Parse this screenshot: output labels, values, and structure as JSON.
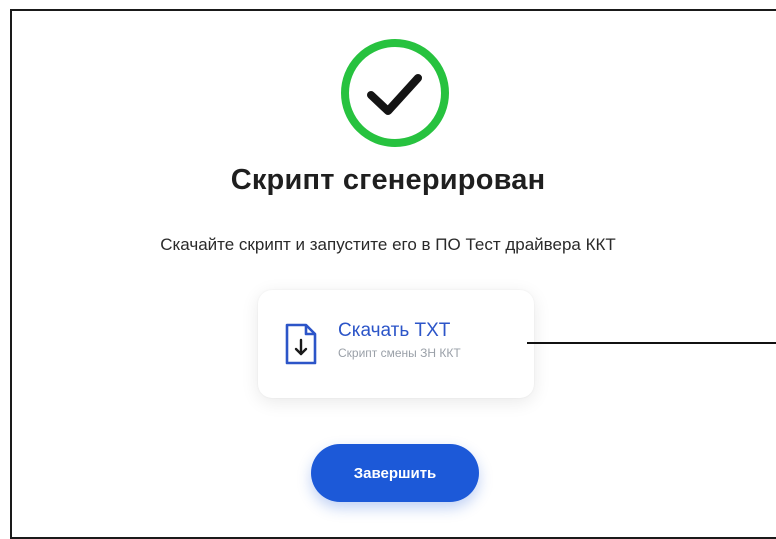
{
  "dialog": {
    "title": "Скрипт сгенерирован",
    "subtitle": "Скачайте скрипт и запустите его в ПО Тест драйвера ККТ",
    "status_icon": "check-circle-icon"
  },
  "download": {
    "label": "Скачать TXT",
    "caption": "Скрипт смены ЗН ККТ",
    "icon": "file-download-icon"
  },
  "actions": {
    "finish_label": "Завершить"
  },
  "colors": {
    "success": "#27c23f",
    "accent": "#1c59d8",
    "link": "#2c55c8"
  }
}
